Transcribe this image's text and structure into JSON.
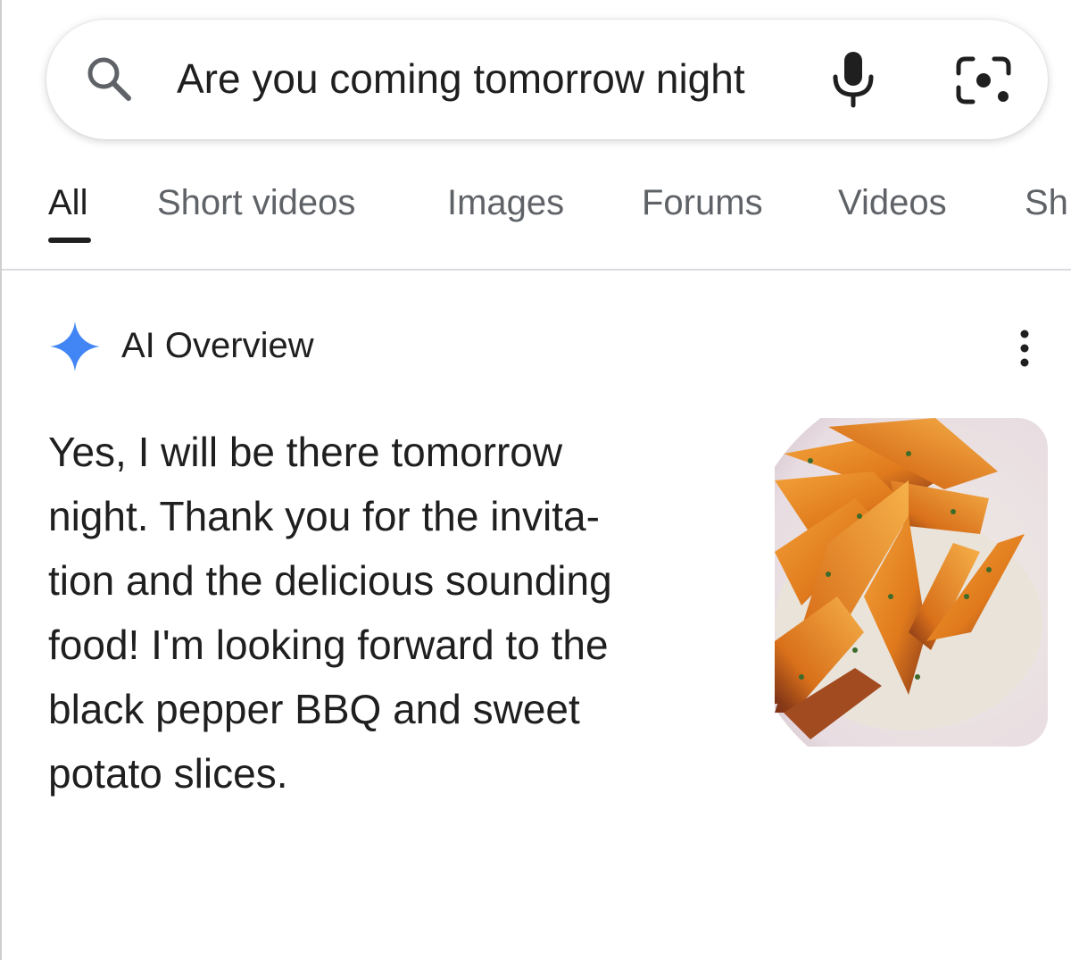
{
  "search": {
    "query": "Are you coming tomorrow night",
    "icons": [
      "search-icon",
      "mic-icon",
      "lens-icon"
    ]
  },
  "tabs": [
    {
      "label": "All",
      "active": true
    },
    {
      "label": "Short videos",
      "active": false
    },
    {
      "label": "Images",
      "active": false
    },
    {
      "label": "Forums",
      "active": false
    },
    {
      "label": "Videos",
      "active": false
    },
    {
      "label": "Sh",
      "active": false
    }
  ],
  "ai_overview": {
    "title": "AI Overview",
    "answer_lines": [
      "Yes, I will be there tomorrow",
      "night. Thank you for the invita-",
      "tion and the delicious sounding",
      "food! I'm looking forward to the",
      "black pepper BBQ and sweet",
      "potato slices."
    ],
    "image_subject": "roasted sweet potato wedges in a bowl"
  },
  "colors": {
    "ai_star": "#4285f4",
    "tab_active": "#1f1f1f",
    "tab_inactive": "#5f6368",
    "divider": "#dadce0"
  }
}
